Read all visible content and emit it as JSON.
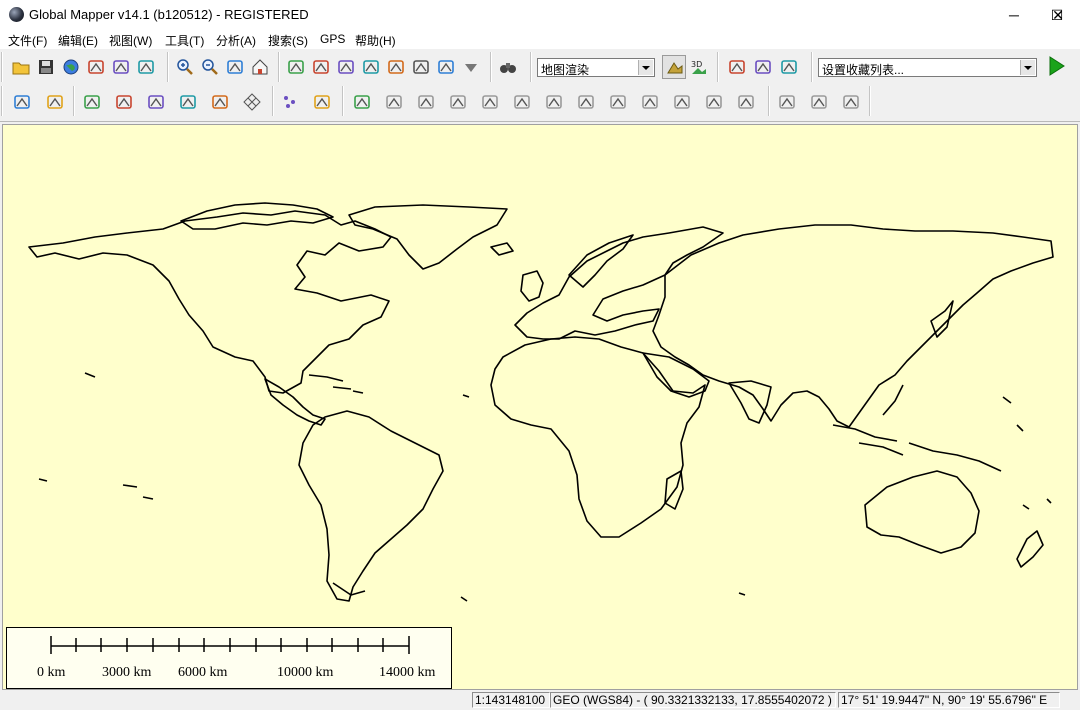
{
  "window": {
    "title": "Global Mapper v14.1 (b120512) - REGISTERED",
    "minimize_glyph": "─",
    "maximize_glyph": "☐",
    "close_glyph": "✕"
  },
  "menu": [
    "文件(F)",
    "编辑(E)",
    "视图(W)",
    "工具(T)",
    "分析(A)",
    "搜索(S)",
    "GPS",
    "帮助(H)"
  ],
  "toolbar1": {
    "buttons": [
      "open-icon",
      "save-icon",
      "globe-icon",
      "layers-icon",
      "config-icon",
      "tools-icon",
      "zoom-in-icon",
      "zoom-out-icon",
      "full-view-icon",
      "home-icon",
      "zoom-box-icon",
      "pan-icon",
      "measure-icon",
      "info-icon",
      "path-profile-icon",
      "view-shed-icon",
      "digitizer-icon",
      "drop-down-icon",
      "binoculars-icon"
    ],
    "render_combo": "地图渲染",
    "favorites_combo": "设置收藏列表..."
  },
  "toolbar2": {
    "buttons": [
      "edit-area-icon",
      "edit-line-icon",
      "feature-a-icon",
      "feature-b-icon",
      "feature-c-icon",
      "code-icon",
      "circle-feature-icon",
      "grid-icon",
      "points-icon",
      "vertex-icon",
      "draw-icon",
      "layer-a-icon",
      "layer-b-icon",
      "layer-c-icon",
      "layer-d-icon",
      "layer-e-icon",
      "layer-f-icon",
      "layer-g-icon",
      "layer-h-icon",
      "layer-i-icon",
      "layer-j-icon",
      "layer-k-icon",
      "layer-l-icon",
      "scale-icon",
      "rotate-icon",
      "undo-icon"
    ]
  },
  "scale_bar": {
    "labels": [
      "0 km",
      "3000 km",
      "6000 km",
      "10000 km",
      "14000 km"
    ]
  },
  "status": {
    "scale": "1:143148100",
    "projection": "GEO (WGS84) - ( 90.3321332133, 17.8555402072 )",
    "dms": "17° 51' 19.9447\" N, 90° 19' 55.6796\" E"
  },
  "colors": {
    "map_background": "#ffffcc",
    "coastline": "#000000",
    "go_arrow": "#1aa31a"
  }
}
